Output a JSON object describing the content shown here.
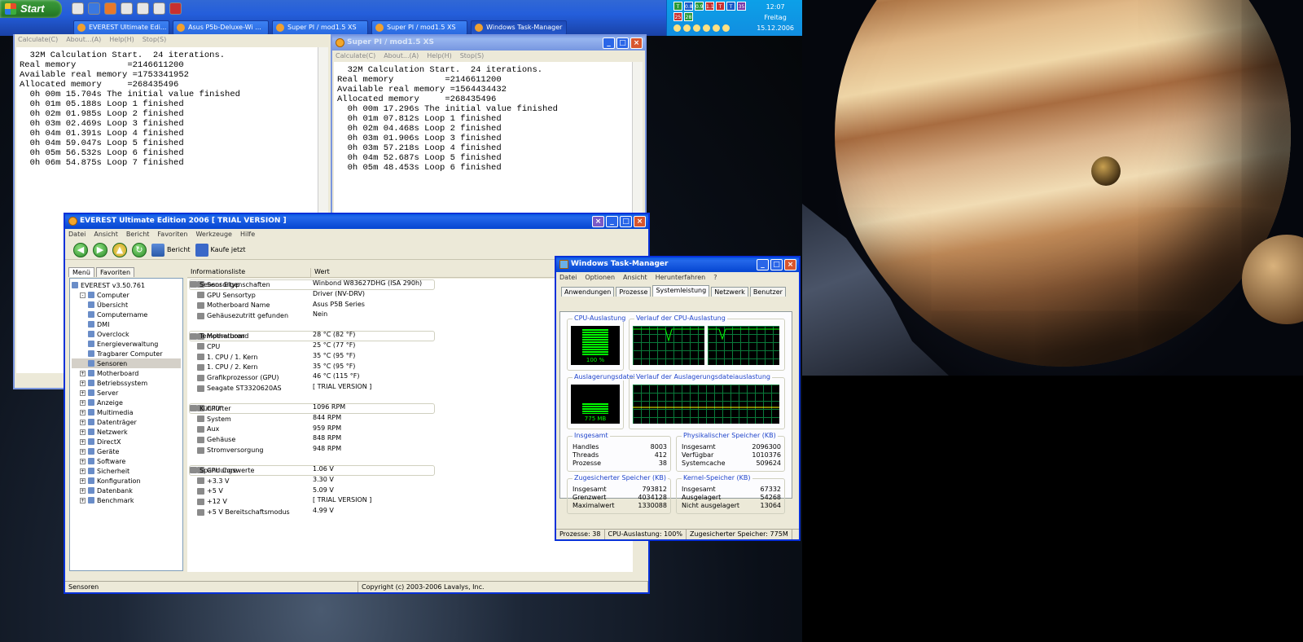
{
  "taskbar": {
    "start_label": "Start",
    "items": [
      {
        "label": "EVEREST Ultimate Edi..."
      },
      {
        "label": "Asus P5b-Deluxe-Wi ..."
      },
      {
        "label": "Super PI / mod1.5 XS"
      },
      {
        "label": "Super PI / mod1.5 XS"
      },
      {
        "label": "Windows Task-Manager"
      }
    ],
    "tray_values": [
      "T",
      "0.8",
      "0.9",
      "1.1",
      "T",
      "T",
      "35",
      "25",
      "28"
    ],
    "clock": {
      "time": "12:07",
      "day": "Freitag",
      "date": "15.12.2006"
    }
  },
  "superpi1": {
    "menu": [
      "Calculate(C)",
      "About...(A)",
      "Help(H)",
      "Stop(S)"
    ],
    "lines": [
      "  32M Calculation Start.  24 iterations.",
      "Real memory          =2146611200",
      "Available real memory =1753341952",
      "Allocated memory     =268435496",
      "  0h 00m 15.704s The initial value finished",
      "  0h 01m 05.188s Loop 1 finished",
      "  0h 02m 01.985s Loop 2 finished",
      "  0h 03m 02.469s Loop 3 finished",
      "  0h 04m 01.391s Loop 4 finished",
      "  0h 04m 59.047s Loop 5 finished",
      "  0h 05m 56.532s Loop 6 finished",
      "  0h 06m 54.875s Loop 7 finished"
    ]
  },
  "superpi2": {
    "title": "Super PI / mod1.5 XS",
    "menu": [
      "Calculate(C)",
      "About...(A)",
      "Help(H)",
      "Stop(S)"
    ],
    "lines": [
      "  32M Calculation Start.  24 iterations.",
      "Real memory          =2146611200",
      "Available real memory =1564434432",
      "Allocated memory     =268435496",
      "  0h 00m 17.296s The initial value finished",
      "  0h 01m 07.812s Loop 1 finished",
      "  0h 02m 04.468s Loop 2 finished",
      "  0h 03m 01.906s Loop 3 finished",
      "  0h 03m 57.218s Loop 4 finished",
      "  0h 04m 52.687s Loop 5 finished",
      "  0h 05m 48.453s Loop 6 finished"
    ]
  },
  "everest": {
    "title": "EVEREST Ultimate Edition 2006  [ TRIAL VERSION ]",
    "menu": [
      "Datei",
      "Ansicht",
      "Bericht",
      "Favoriten",
      "Werkzeuge",
      "Hilfe"
    ],
    "toolbar": {
      "report": "Bericht",
      "buy": "Kaufe jetzt"
    },
    "tabs": [
      "Menü",
      "Favoriten"
    ],
    "tree": [
      {
        "label": "EVEREST v3.50.761",
        "level": 0
      },
      {
        "label": "Computer",
        "level": 1,
        "pm": "-"
      },
      {
        "label": "Übersicht",
        "level": 2
      },
      {
        "label": "Computername",
        "level": 2
      },
      {
        "label": "DMI",
        "level": 2
      },
      {
        "label": "Overclock",
        "level": 2
      },
      {
        "label": "Energieverwaltung",
        "level": 2
      },
      {
        "label": "Tragbarer Computer",
        "level": 2
      },
      {
        "label": "Sensoren",
        "level": 2,
        "selected": true
      },
      {
        "label": "Motherboard",
        "level": 1,
        "pm": "+"
      },
      {
        "label": "Betriebssystem",
        "level": 1,
        "pm": "+"
      },
      {
        "label": "Server",
        "level": 1,
        "pm": "+"
      },
      {
        "label": "Anzeige",
        "level": 1,
        "pm": "+"
      },
      {
        "label": "Multimedia",
        "level": 1,
        "pm": "+"
      },
      {
        "label": "Datenträger",
        "level": 1,
        "pm": "+"
      },
      {
        "label": "Netzwerk",
        "level": 1,
        "pm": "+"
      },
      {
        "label": "DirectX",
        "level": 1,
        "pm": "+"
      },
      {
        "label": "Geräte",
        "level": 1,
        "pm": "+"
      },
      {
        "label": "Software",
        "level": 1,
        "pm": "+"
      },
      {
        "label": "Sicherheit",
        "level": 1,
        "pm": "+"
      },
      {
        "label": "Konfiguration",
        "level": 1,
        "pm": "+"
      },
      {
        "label": "Datenbank",
        "level": 1,
        "pm": "+"
      },
      {
        "label": "Benchmark",
        "level": 1,
        "pm": "+"
      }
    ],
    "columns": [
      "Informationsliste",
      "Wert"
    ],
    "rows": [
      {
        "type": "grp",
        "k": "Sensor Eigenschaften"
      },
      {
        "type": "sub",
        "k": "Sensortyp",
        "v": "Winbond W83627DHG  (ISA 290h)"
      },
      {
        "type": "sub",
        "k": "GPU Sensortyp",
        "v": "Driver  (NV-DRV)"
      },
      {
        "type": "sub",
        "k": "Motherboard Name",
        "v": "Asus P5B Series"
      },
      {
        "type": "sub",
        "k": "Gehäusezutritt gefunden",
        "v": "Nein"
      },
      {
        "type": "gap"
      },
      {
        "type": "grp",
        "k": "Temperaturen"
      },
      {
        "type": "sub",
        "k": "Motherboard",
        "v": "28 °C  (82 °F)"
      },
      {
        "type": "sub",
        "k": "CPU",
        "v": "25 °C  (77 °F)"
      },
      {
        "type": "sub",
        "k": "1. CPU / 1. Kern",
        "v": "35 °C  (95 °F)"
      },
      {
        "type": "sub",
        "k": "1. CPU / 2. Kern",
        "v": "35 °C  (95 °F)"
      },
      {
        "type": "sub",
        "k": "Grafikprozessor (GPU)",
        "v": "46 °C  (115 °F)"
      },
      {
        "type": "sub",
        "k": "Seagate ST3320620AS",
        "v": "[ TRIAL VERSION ]"
      },
      {
        "type": "gap"
      },
      {
        "type": "grp",
        "k": "Kühllüfter"
      },
      {
        "type": "sub",
        "k": "CPU",
        "v": "1096 RPM"
      },
      {
        "type": "sub",
        "k": "System",
        "v": "844 RPM"
      },
      {
        "type": "sub",
        "k": "Aux",
        "v": "959 RPM"
      },
      {
        "type": "sub",
        "k": "Gehäuse",
        "v": "848 RPM"
      },
      {
        "type": "sub",
        "k": "Stromversorgung",
        "v": "948 RPM"
      },
      {
        "type": "gap"
      },
      {
        "type": "grp",
        "k": "Spannungswerte"
      },
      {
        "type": "sub",
        "k": "CPU Core",
        "v": "1.06 V"
      },
      {
        "type": "sub",
        "k": "+3.3 V",
        "v": "3.30 V"
      },
      {
        "type": "sub",
        "k": "+5 V",
        "v": "5.09 V"
      },
      {
        "type": "sub",
        "k": "+12 V",
        "v": "[ TRIAL VERSION ]"
      },
      {
        "type": "sub",
        "k": "+5 V Bereitschaftsmodus",
        "v": "4.99 V"
      }
    ],
    "status": {
      "left": "Sensoren",
      "right": "Copyright (c) 2003-2006 Lavalys, Inc."
    }
  },
  "taskmgr": {
    "title": "Windows Task-Manager",
    "menu": [
      "Datei",
      "Optionen",
      "Ansicht",
      "Herunterfahren",
      "?"
    ],
    "tabs": [
      "Anwendungen",
      "Prozesse",
      "Systemleistung",
      "Netzwerk",
      "Benutzer"
    ],
    "cpu_label": "CPU-Auslastung",
    "cpu_value": "100 %",
    "cpu_level": 1.0,
    "cpu_hist_label": "Verlauf der CPU-Auslastung",
    "pf_label": "Auslagerungsdatei",
    "pf_value": "775 MB",
    "pf_level": 0.4,
    "pf_hist_label": "Verlauf der Auslagerungsdateiauslastung",
    "totals": {
      "title": "Insgesamt",
      "rows": [
        [
          "Handles",
          "8003"
        ],
        [
          "Threads",
          "412"
        ],
        [
          "Prozesse",
          "38"
        ]
      ]
    },
    "physical": {
      "title": "Physikalischer Speicher (KB)",
      "rows": [
        [
          "Insgesamt",
          "2096300"
        ],
        [
          "Verfügbar",
          "1010376"
        ],
        [
          "Systemcache",
          "509624"
        ]
      ]
    },
    "commit": {
      "title": "Zugesicherter Speicher (KB)",
      "rows": [
        [
          "Insgesamt",
          "793812"
        ],
        [
          "Grenzwert",
          "4034128"
        ],
        [
          "Maximalwert",
          "1330088"
        ]
      ]
    },
    "kernel": {
      "title": "Kernel-Speicher (KB)",
      "rows": [
        [
          "Insgesamt",
          "67332"
        ],
        [
          "Ausgelagert",
          "54268"
        ],
        [
          "Nicht ausgelagert",
          "13064"
        ]
      ]
    },
    "status": [
      "Prozesse: 38",
      "CPU-Auslastung: 100%",
      "Zugesicherter Speicher: 775M"
    ]
  }
}
